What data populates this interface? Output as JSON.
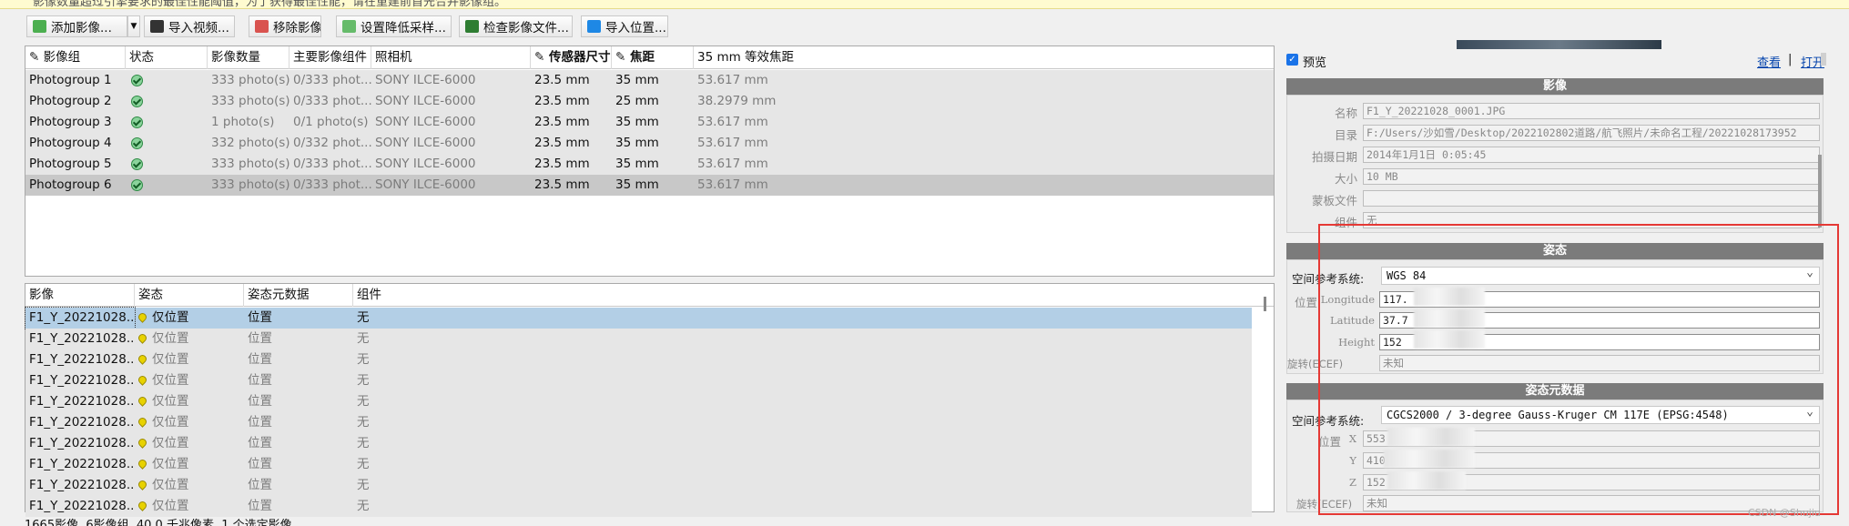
{
  "banner": "影像数量超过引擎要求的最佳性能阈值，为了获得最佳性能，请在重建前首先合并影像组。",
  "toolbar": {
    "add_photos": "添加影像...",
    "import_video": "导入视频...",
    "remove_photos": "移除影像",
    "downsample": "设置降低采样...",
    "check_files": "检查影像文件...",
    "import_positions": "导入位置..."
  },
  "photogroups": {
    "columns": [
      "影像组",
      "状态",
      "影像数量",
      "主要影像组件",
      "照相机",
      "传感器尺寸",
      "焦距",
      "35 mm 等效焦距"
    ],
    "rows": [
      {
        "name": "Photogroup 1",
        "count": "333 photo(s)",
        "main": "0/333 phot...",
        "camera": "SONY ILCE-6000",
        "sensor": "23.5 mm",
        "focal": "35 mm",
        "eq": "53.617 mm"
      },
      {
        "name": "Photogroup 2",
        "count": "333 photo(s)",
        "main": "0/333 phot...",
        "camera": "SONY ILCE-6000",
        "sensor": "23.5 mm",
        "focal": "25 mm",
        "eq": "38.2979 mm"
      },
      {
        "name": "Photogroup 3",
        "count": "1 photo(s)",
        "main": "0/1 photo(s)",
        "camera": "SONY ILCE-6000",
        "sensor": "23.5 mm",
        "focal": "35 mm",
        "eq": "53.617 mm"
      },
      {
        "name": "Photogroup 4",
        "count": "332 photo(s)",
        "main": "0/332 phot...",
        "camera": "SONY ILCE-6000",
        "sensor": "23.5 mm",
        "focal": "35 mm",
        "eq": "53.617 mm"
      },
      {
        "name": "Photogroup 5",
        "count": "333 photo(s)",
        "main": "0/333 phot...",
        "camera": "SONY ILCE-6000",
        "sensor": "23.5 mm",
        "focal": "35 mm",
        "eq": "53.617 mm"
      },
      {
        "name": "Photogroup 6",
        "count": "333 photo(s)",
        "main": "0/333 phot...",
        "camera": "SONY ILCE-6000",
        "sensor": "23.5 mm",
        "focal": "35 mm",
        "eq": "53.617 mm"
      }
    ]
  },
  "photos": {
    "columns": [
      "影像",
      "姿态",
      "姿态元数据",
      "组件"
    ],
    "rows": [
      {
        "name": "F1_Y_20221028...",
        "pose": "仅位置",
        "meta": "位置",
        "comp": "无"
      },
      {
        "name": "F1_Y_20221028...",
        "pose": "仅位置",
        "meta": "位置",
        "comp": "无"
      },
      {
        "name": "F1_Y_20221028...",
        "pose": "仅位置",
        "meta": "位置",
        "comp": "无"
      },
      {
        "name": "F1_Y_20221028...",
        "pose": "仅位置",
        "meta": "位置",
        "comp": "无"
      },
      {
        "name": "F1_Y_20221028...",
        "pose": "仅位置",
        "meta": "位置",
        "comp": "无"
      },
      {
        "name": "F1_Y_20221028...",
        "pose": "仅位置",
        "meta": "位置",
        "comp": "无"
      },
      {
        "name": "F1_Y_20221028...",
        "pose": "仅位置",
        "meta": "位置",
        "comp": "无"
      },
      {
        "name": "F1_Y_20221028...",
        "pose": "仅位置",
        "meta": "位置",
        "comp": "无"
      },
      {
        "name": "F1_Y_20221028...",
        "pose": "仅位置",
        "meta": "位置",
        "comp": "无"
      },
      {
        "name": "F1_Y_20221028...",
        "pose": "仅位置",
        "meta": "位置",
        "comp": "无"
      }
    ]
  },
  "status": "1665影像, 6影像组, 40.0 千兆像素, 1 个选定影像",
  "preview": {
    "label": "预览",
    "view": "查看",
    "sep": "|",
    "open": "打开"
  },
  "image_section": {
    "title": "影像",
    "name_label": "名称",
    "name": "F1_Y_20221028_0001.JPG",
    "dir_label": "目录",
    "dir": "F:/Users/沙如雪/Desktop/2022102802道路/航飞照片/未命名工程/20221028173952",
    "date_label": "拍摄日期",
    "date": "2014年1月1日 0:05:45",
    "size_label": "大小",
    "size": "10 MB",
    "mask_label": "蒙板文件",
    "mask": "",
    "comp_label": "组件",
    "comp": "无"
  },
  "pose_section": {
    "title": "姿态",
    "srs_label": "空间参考系统:",
    "srs": "WGS 84",
    "pos_label": "位置",
    "lon_label": "Longitude",
    "lon": "117.",
    "lat_label": "Latitude",
    "lat": "37.7",
    "h_label": "Height",
    "h": "152",
    "rot_label": "旋转(ECEF)",
    "rot": "未知"
  },
  "meta_section": {
    "title": "姿态元数据",
    "srs_label": "空间参考系统:",
    "srs": "CGCS2000 / 3-degree Gauss-Kruger CM 117E (EPSG:4548)",
    "pos_label": "位置",
    "x_label": "X",
    "x": "553",
    "y_label": "Y",
    "y": "410",
    "z_label": "Z",
    "z": "152",
    "rot_label": "旋转(ECEF)",
    "rot": "未知"
  },
  "watermark": "CSDN @Shujiu",
  "colors": {
    "selection": "#b3cfe6",
    "highlight_box": "#e53935",
    "section_header": "#7b7b7b"
  }
}
